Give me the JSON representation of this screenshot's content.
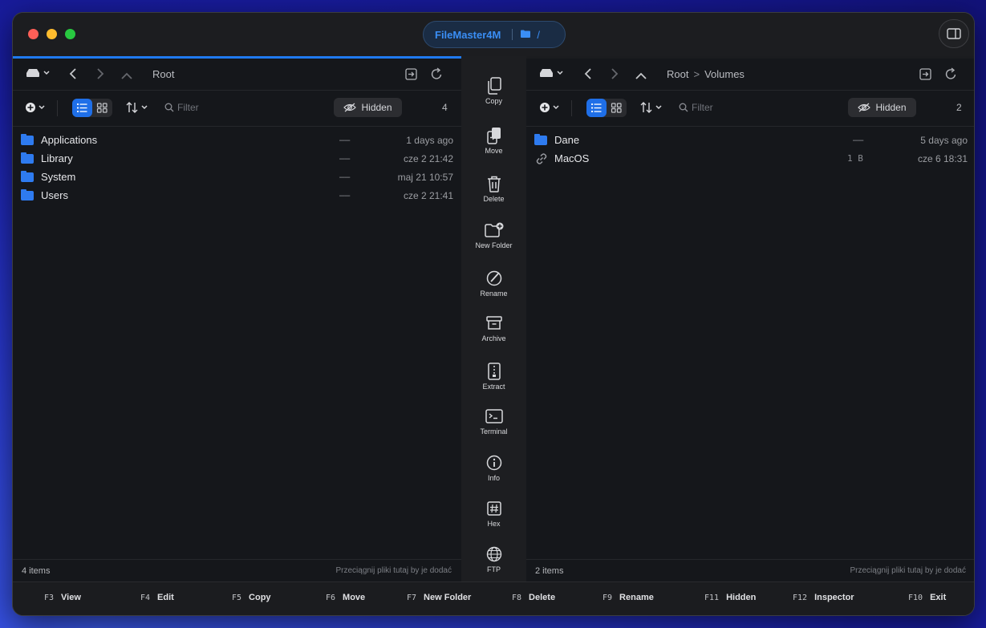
{
  "window": {
    "app_title": "FileMaster4M",
    "current_path": "/"
  },
  "left_pane": {
    "breadcrumbs": [
      "Root"
    ],
    "filter_placeholder": "Filter",
    "hidden_label": "Hidden",
    "count": "4",
    "rows": [
      {
        "name": "Applications",
        "size": "––",
        "date": "1 days ago",
        "icon": "folder-icon"
      },
      {
        "name": "Library",
        "size": "––",
        "date": "cze 2 21:42",
        "icon": "folder-icon"
      },
      {
        "name": "System",
        "size": "––",
        "date": "maj 21 10:57",
        "icon": "folder-icon"
      },
      {
        "name": "Users",
        "size": "––",
        "date": "cze 2 21:41",
        "icon": "folder-icon"
      }
    ],
    "status_left": "4 items",
    "status_right": "Przeciągnij pliki tutaj by je dodać"
  },
  "right_pane": {
    "breadcrumbs": [
      "Root",
      "Volumes"
    ],
    "breadcrumb_sep": ">",
    "filter_placeholder": "Filter",
    "hidden_label": "Hidden",
    "count": "2",
    "rows": [
      {
        "name": "Dane",
        "size": "––",
        "date": "5 days ago",
        "icon": "folder-icon"
      },
      {
        "name": "MacOS",
        "size": "1 B",
        "date": "cze 6 18:31",
        "icon": "link-icon"
      }
    ],
    "status_left": "2 items",
    "status_right": "Przeciągnij pliki tutaj by je dodać"
  },
  "actions": [
    {
      "label": "Copy",
      "icon": "copy-icon"
    },
    {
      "label": "Move",
      "icon": "move-icon"
    },
    {
      "label": "Delete",
      "icon": "trash-icon"
    },
    {
      "label": "New Folder",
      "icon": "new-folder-icon"
    },
    {
      "label": "Rename",
      "icon": "rename-icon"
    },
    {
      "label": "Archive",
      "icon": "archive-icon"
    },
    {
      "label": "Extract",
      "icon": "extract-icon"
    },
    {
      "label": "Terminal",
      "icon": "terminal-icon"
    },
    {
      "label": "Info",
      "icon": "info-icon"
    },
    {
      "label": "Hex",
      "icon": "hex-icon"
    },
    {
      "label": "FTP",
      "icon": "globe-icon"
    }
  ],
  "fkeys": [
    {
      "key": "F3",
      "label": "View"
    },
    {
      "key": "F4",
      "label": "Edit"
    },
    {
      "key": "F5",
      "label": "Copy"
    },
    {
      "key": "F6",
      "label": "Move"
    },
    {
      "key": "F7",
      "label": "New Folder"
    },
    {
      "key": "F8",
      "label": "Delete"
    },
    {
      "key": "F9",
      "label": "Rename"
    },
    {
      "key": "F11",
      "label": "Hidden"
    },
    {
      "key": "F12",
      "label": "Inspector"
    },
    {
      "key": "F10",
      "label": "Exit"
    }
  ],
  "colors": {
    "accent": "#1f6fe8",
    "folder": "#2e7bf0",
    "title": "#3a8ef5"
  }
}
